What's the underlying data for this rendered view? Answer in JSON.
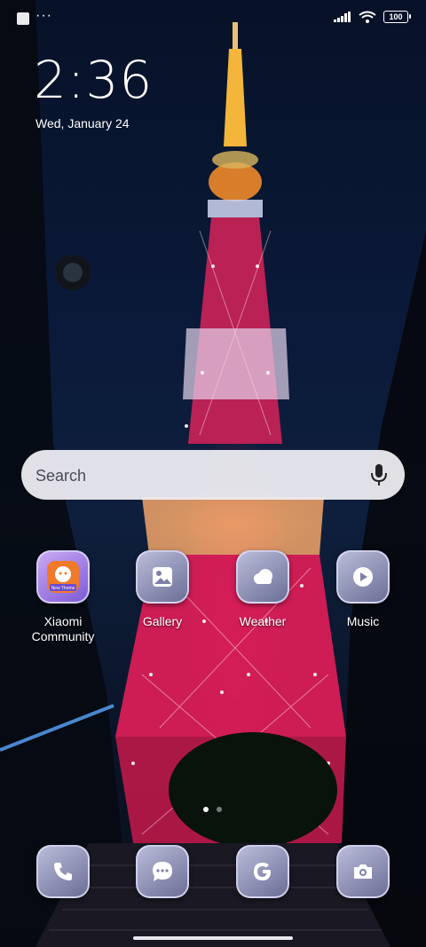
{
  "status_bar": {
    "notification_icon": "square-icon",
    "more_label": "···",
    "battery_level": "100"
  },
  "clock": {
    "time": "2:36",
    "date": "Wed, January 24"
  },
  "search": {
    "placeholder": "Search"
  },
  "apps": [
    {
      "label": "Xiaomi\nCommunity",
      "icon": "xiaomi-community-icon"
    },
    {
      "label": "Gallery",
      "icon": "gallery-icon"
    },
    {
      "label": "Weather",
      "icon": "weather-icon"
    },
    {
      "label": "Music",
      "icon": "music-icon"
    }
  ],
  "mini_badge": "New Theme",
  "dock": [
    {
      "icon": "phone-icon"
    },
    {
      "icon": "messages-icon"
    },
    {
      "icon": "google-icon"
    },
    {
      "icon": "camera-icon"
    }
  ],
  "page_indicator": {
    "count": 2,
    "active_index": 0
  },
  "colors": {
    "accent_orange": "#f0792a",
    "icon_bg": "#8a8db4"
  }
}
